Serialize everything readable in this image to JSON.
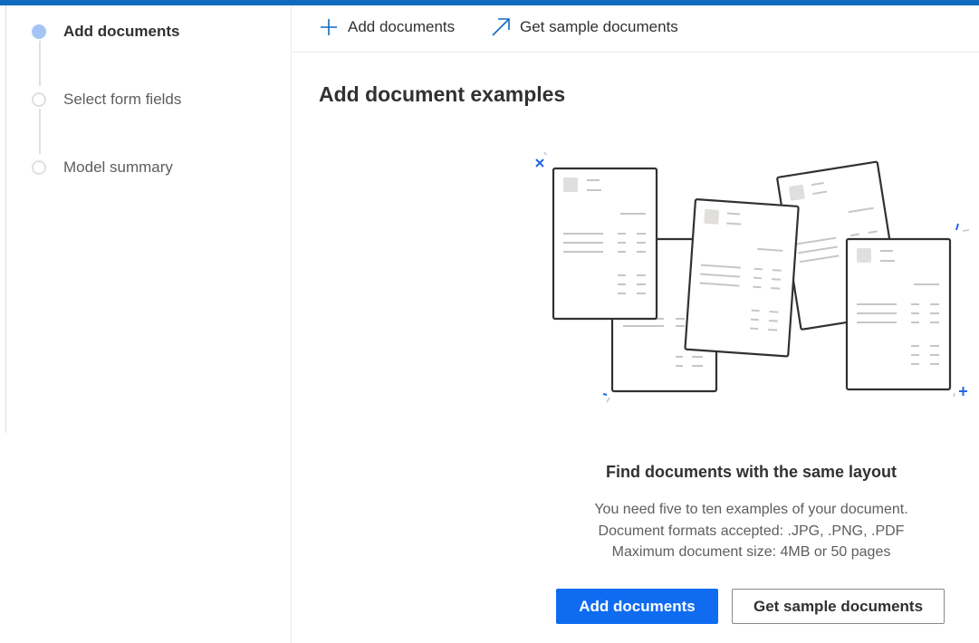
{
  "stepper": {
    "steps": [
      {
        "label": "Add documents",
        "state": "active"
      },
      {
        "label": "Select form fields",
        "state": "inactive"
      },
      {
        "label": "Model summary",
        "state": "inactive"
      }
    ]
  },
  "commandbar": {
    "add_label": "Add documents",
    "add_icon": "plus-icon",
    "sample_label": "Get sample documents",
    "sample_icon": "arrow-up-right-icon"
  },
  "main": {
    "title": "Add document examples",
    "illustration": "stacked-documents-illustration",
    "empty_title": "Find documents with the same layout",
    "desc_lines": [
      "You need five to ten examples of your document.",
      "Document formats accepted: .JPG, .PNG, .PDF",
      "Maximum document size: 4MB or 50 pages"
    ],
    "primary_button": "Add documents",
    "secondary_button": "Get sample documents"
  },
  "colors": {
    "accent": "#0f6cbd",
    "primary_button": "#0f6cf0",
    "active_step": "#a3c4f5",
    "sparkle": "#2266e3"
  }
}
